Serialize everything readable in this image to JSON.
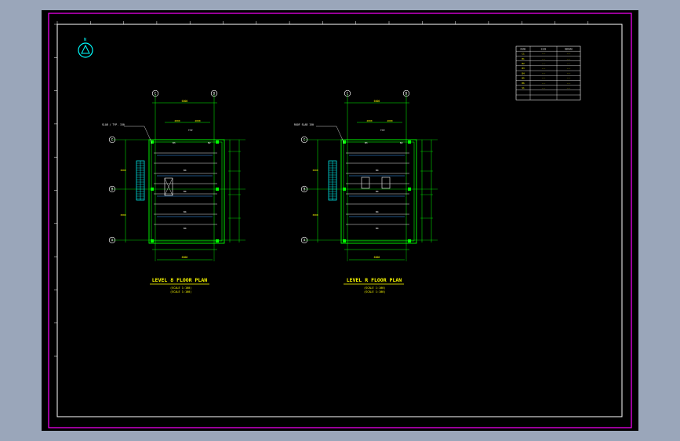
{
  "colors": {
    "background": "#9aa6ba",
    "sheet": "#000000",
    "frame_outer": "#ff00ff",
    "frame_inner": "#ffffff",
    "plan_lines": "#00ff00",
    "text": "#ffff00",
    "stairs": "#00ffff",
    "beams": "#3aa0ff",
    "dims": "#00ff00"
  },
  "north_arrow": {
    "label": "N",
    "icon": "north-arrow-icon"
  },
  "plans": [
    {
      "id": "level-8",
      "title": "LEVEL 8 FLOOR PLAN",
      "subtitle_1": "(SCALE 1:100)",
      "subtitle_2": "(SCALE 1:100)",
      "note": "SLAB / TYP. 150",
      "grid_col_a": "C",
      "grid_col_b": "D",
      "grid_row_top": "C",
      "grid_row_mid": "B",
      "grid_row_bot": "A",
      "dim_top": "6000",
      "dim_bottom": "6000",
      "room_tag": "TYP"
    },
    {
      "id": "level-r",
      "title": "LEVEL R FLOOR PLAN",
      "subtitle_1": "(SCALE 1:100)",
      "subtitle_2": "(SCALE 1:100)",
      "note": "ROOF SLAB 150",
      "grid_col_a": "C",
      "grid_col_b": "D",
      "grid_row_top": "C",
      "grid_row_mid": "B",
      "grid_row_bot": "A",
      "dim_top": "6000",
      "dim_bottom": "6000",
      "room_tag": "TYP"
    }
  ],
  "legend_table": {
    "headers": [
      "MARK",
      "SIZE",
      "REMARK"
    ],
    "rows": [
      [
        "C1",
        "---",
        "---"
      ],
      [
        "B1",
        "---",
        "---"
      ],
      [
        "B2",
        "---",
        "---"
      ],
      [
        "B3",
        "---",
        "---"
      ],
      [
        "B4",
        "---",
        "---"
      ],
      [
        "B5",
        "---",
        "---"
      ],
      [
        "B6",
        "---",
        "---"
      ],
      [
        "S1",
        "---",
        "---"
      ]
    ]
  }
}
